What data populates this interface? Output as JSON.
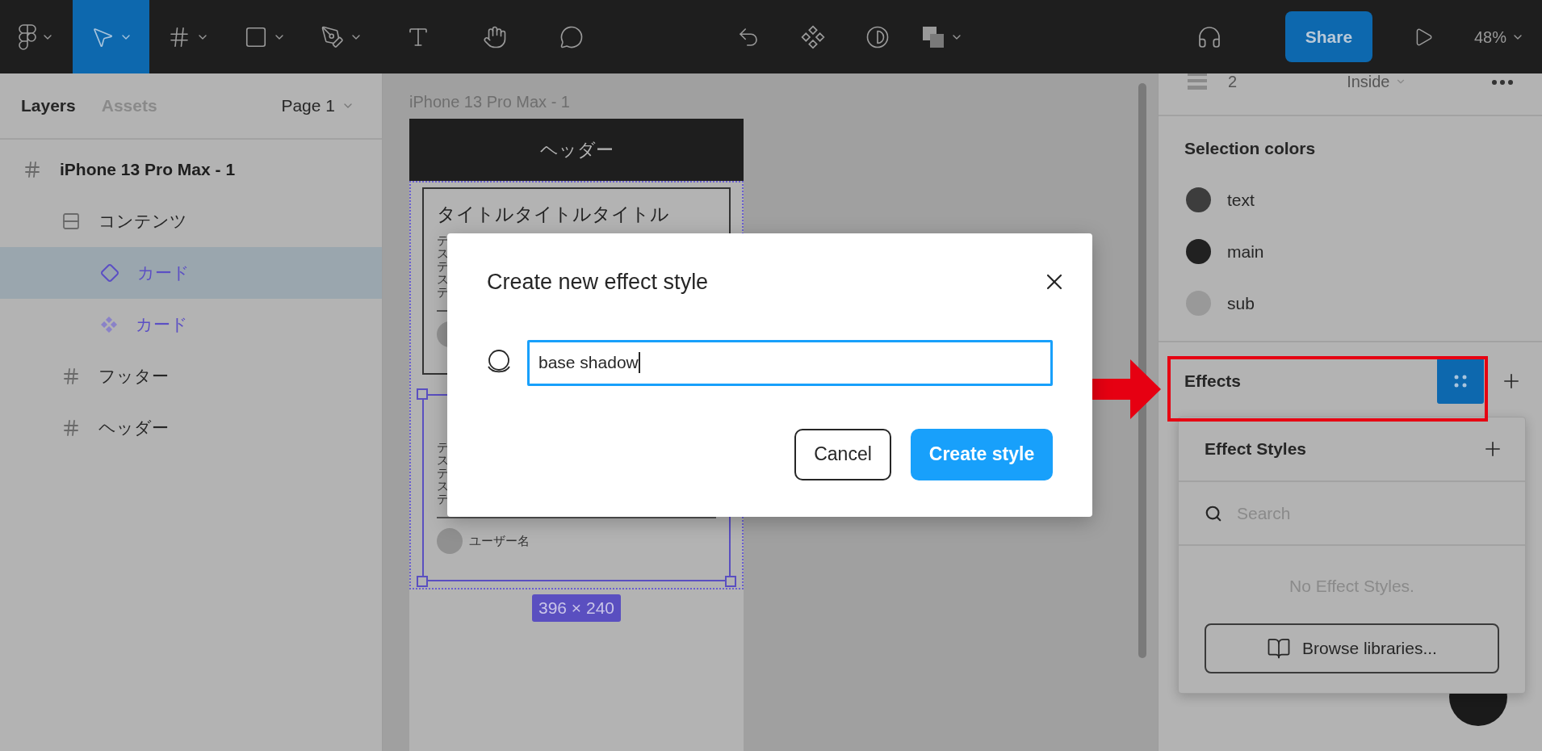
{
  "toolbar": {
    "tools": [
      {
        "kind": "logo",
        "selected": false,
        "menu": true
      },
      {
        "kind": "move",
        "selected": true,
        "menu": true
      },
      {
        "kind": "frame",
        "selected": false,
        "menu": true
      },
      {
        "kind": "rectangle",
        "selected": false,
        "menu": true
      },
      {
        "kind": "pen",
        "selected": false,
        "menu": true
      },
      {
        "kind": "text",
        "selected": false,
        "menu": false
      },
      {
        "kind": "hand",
        "selected": false,
        "menu": false
      },
      {
        "kind": "comment",
        "selected": false,
        "menu": false
      }
    ],
    "center_tools": [
      {
        "kind": "reset",
        "menu": false
      },
      {
        "kind": "component",
        "menu": false
      },
      {
        "kind": "mask",
        "menu": false
      },
      {
        "kind": "boolean",
        "menu": true
      }
    ],
    "share_button": "Share",
    "zoom": "48%"
  },
  "layers_panel": {
    "tabs": [
      {
        "label": "Layers",
        "selected": true
      },
      {
        "label": "Assets",
        "selected": false
      }
    ],
    "page": "Page 1",
    "tree": [
      {
        "label": "iPhone 13 Pro Max - 1",
        "kind": "frame",
        "selected": false,
        "children": [
          {
            "label": "コンテンツ",
            "kind": "autolayout",
            "selected": false,
            "children": [
              {
                "label": "カード",
                "kind": "instance",
                "selected": true
              },
              {
                "label": "カード",
                "kind": "component",
                "selected": false
              }
            ]
          },
          {
            "label": "フッター",
            "kind": "frame",
            "selected": false
          },
          {
            "label": "ヘッダー",
            "kind": "frame",
            "selected": false
          }
        ]
      }
    ]
  },
  "canvas": {
    "frame_label": "iPhone 13 Pro Max - 1",
    "header": "ヘッダー",
    "cards": [
      {
        "title": "タイトルタイトルタイトル",
        "body_lines": [
          "テ",
          "ス",
          "テ",
          "ス",
          "テ"
        ],
        "selected": false
      },
      {
        "body_lines": [
          "テ",
          "ス",
          "テ",
          "ス",
          "テ"
        ],
        "user_name": "ユーザー名",
        "selected": true
      }
    ],
    "dimensions": "396 × 240"
  },
  "properties": {
    "stroke_row": {
      "weight": "2",
      "position": "Inside"
    },
    "selection_colors": {
      "title": "Selection colors",
      "colors": [
        {
          "name": "text",
          "color": "#3d3d3d"
        },
        {
          "name": "main",
          "color": "#212121"
        },
        {
          "name": "sub",
          "color": "#999999"
        }
      ]
    },
    "effects": {
      "title": "Effects"
    }
  },
  "effect_styles_popup": {
    "title": "Effect Styles",
    "search": {
      "placeholder": "Search"
    },
    "empty": "No Effect Styles.",
    "browse_button": "Browse libraries..."
  },
  "modal": {
    "title": "Create new effect style",
    "name_field": {
      "value": "base shadow"
    },
    "buttons": [
      {
        "label": "Cancel",
        "kind": "secondary"
      },
      {
        "label": "Create style",
        "kind": "primary"
      }
    ]
  }
}
